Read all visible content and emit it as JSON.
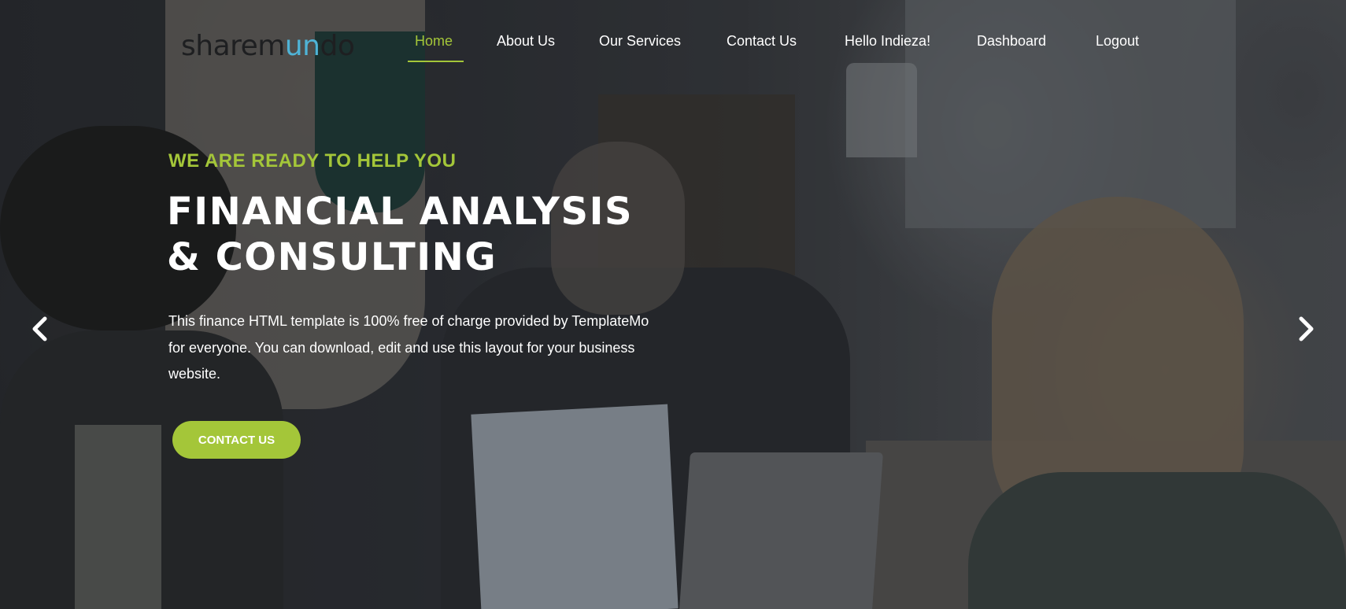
{
  "brand": {
    "logo_prefix": "sharem",
    "logo_accent": "un",
    "logo_suffix": "do",
    "accent_color": "#4fb3d6"
  },
  "nav": {
    "items": [
      {
        "label": "Home",
        "active": true
      },
      {
        "label": "About Us"
      },
      {
        "label": "Our Services"
      },
      {
        "label": "Contact Us"
      },
      {
        "label": "Hello Indieza!"
      },
      {
        "label": "Dashboard"
      },
      {
        "label": "Logout"
      }
    ],
    "active_color": "#a4c639"
  },
  "hero": {
    "kicker": "WE ARE READY TO HELP YOU",
    "title_line1": "FINANCIAL ANALYSIS",
    "title_line2": "& CONSULTING",
    "description_line1": "This finance HTML template is 100% free of charge provided by TemplateMo",
    "description_line2": "for everyone. You can download, edit and use this layout for your business",
    "description_line3": "website.",
    "cta_label": "CONTACT US",
    "cta_color": "#a4c639"
  },
  "carousel": {
    "prev_icon": "chevron-left-icon",
    "next_icon": "chevron-right-icon"
  }
}
